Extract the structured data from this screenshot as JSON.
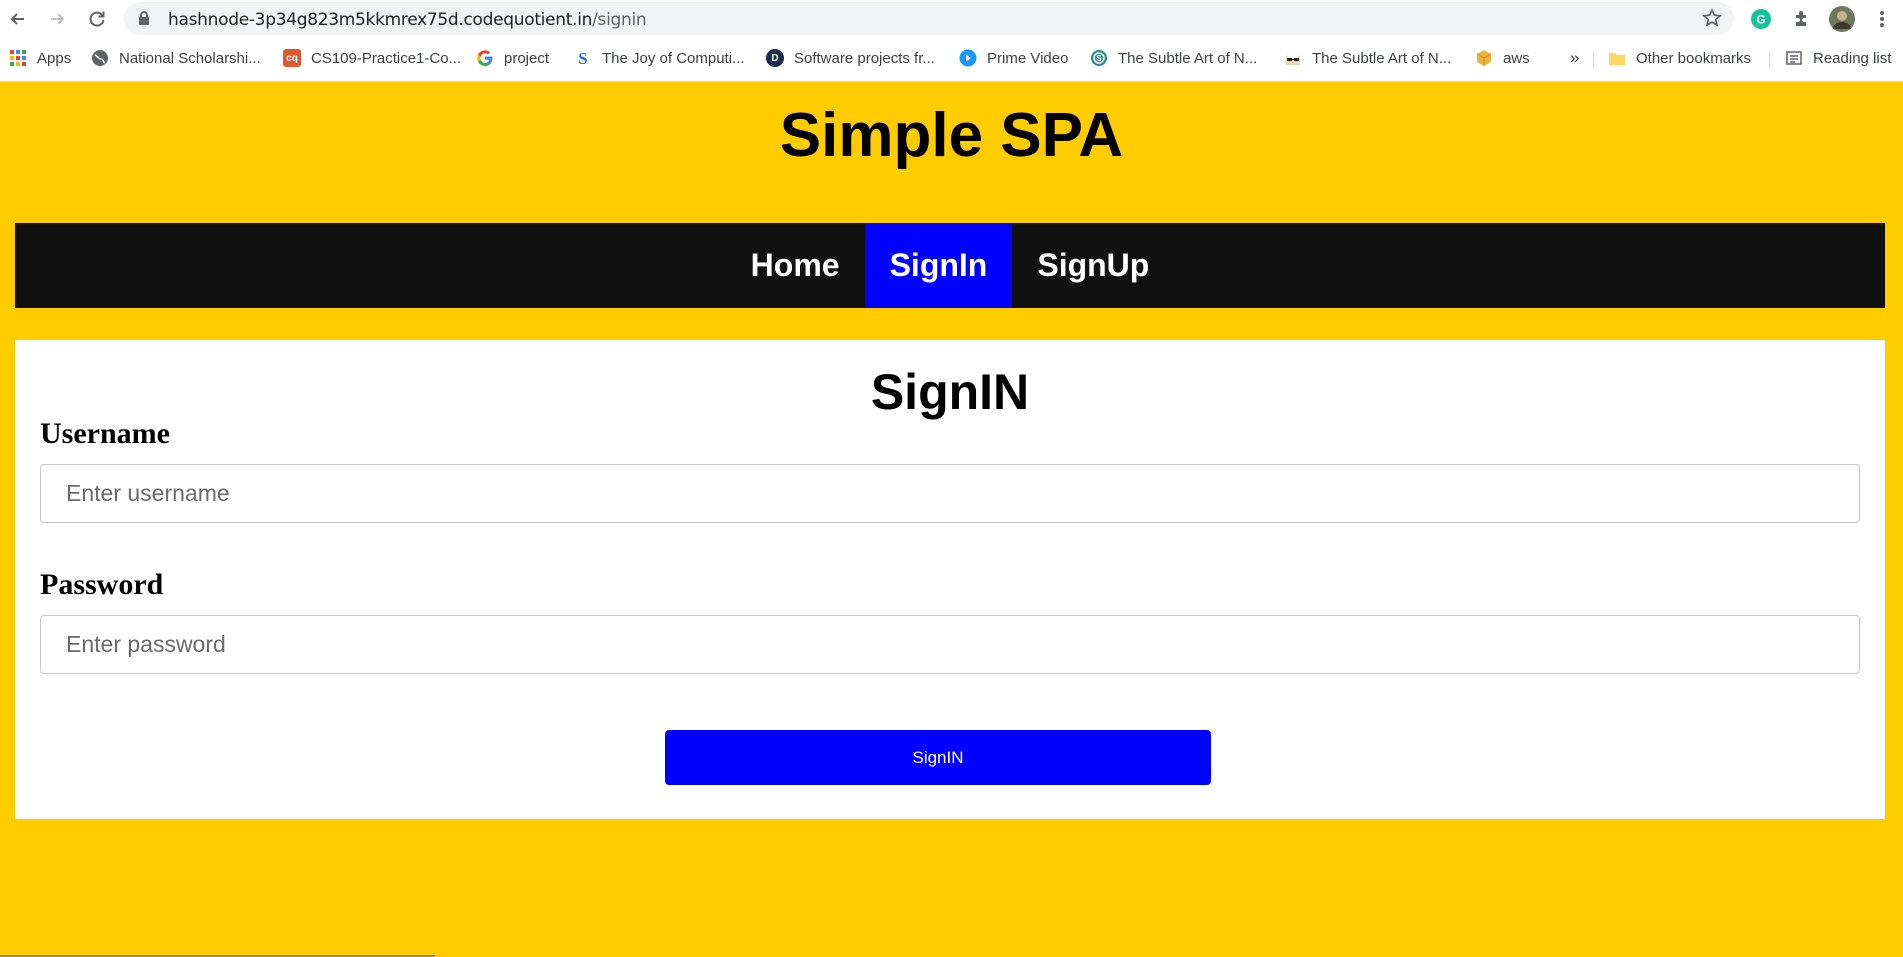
{
  "browser": {
    "url_host": "hashnode-3p34g823m5kkmrex75d.codequotient.in",
    "url_path": "/signin",
    "bookmarks": [
      {
        "label": "Apps",
        "icon": "apps-grid-icon"
      },
      {
        "label": "National Scholarshi...",
        "icon": "globe-icon"
      },
      {
        "label": "CS109-Practice1-Co...",
        "icon": "cq-icon",
        "icon_text": "cq",
        "color": "#e0582d"
      },
      {
        "label": "project",
        "icon": "google-icon"
      },
      {
        "label": "The Joy of Computi...",
        "icon": "swayam-icon"
      },
      {
        "label": "Software projects fr...",
        "icon": "d-logo-icon",
        "icon_text": "D",
        "color": "#1c2b4a"
      },
      {
        "label": "Prime Video",
        "icon": "prime-video-icon",
        "color": "#1a98ff"
      },
      {
        "label": "The Subtle Art of N...",
        "icon": "subtle-art-icon",
        "color": "#2b8a8a"
      },
      {
        "label": "The Subtle Art of N...",
        "icon": "cat-glasses-icon"
      },
      {
        "label": "aws",
        "icon": "aws-box-icon",
        "color": "#f0b43c"
      }
    ],
    "overflow_label": "»",
    "other_bookmarks": "Other bookmarks",
    "reading_list": "Reading list"
  },
  "site": {
    "title": "Simple SPA",
    "nav": [
      {
        "label": "Home",
        "active": false
      },
      {
        "label": "SignIn",
        "active": true
      },
      {
        "label": "SignUp",
        "active": false
      }
    ]
  },
  "form": {
    "title": "SignIN",
    "username_label": "Username",
    "username_placeholder": "Enter username",
    "password_label": "Password",
    "password_placeholder": "Enter password",
    "submit_label": "SignIN"
  },
  "colors": {
    "page_bg": "#ffcc00",
    "nav_bg": "#111111",
    "accent": "#0000ff"
  }
}
